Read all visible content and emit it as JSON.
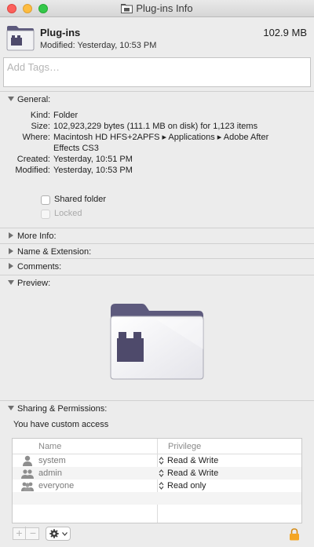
{
  "window": {
    "title": "Plug-ins Info"
  },
  "header": {
    "name": "Plug-ins",
    "size": "102.9 MB",
    "modified": "Modified: Yesterday, 10:53 PM"
  },
  "tags": {
    "placeholder": "Add Tags…",
    "value": ""
  },
  "sections": {
    "general": "General:",
    "more_info": "More Info:",
    "name_extension": "Name & Extension:",
    "comments": "Comments:",
    "preview": "Preview:",
    "sharing": "Sharing & Permissions:"
  },
  "general": {
    "kind_label": "Kind:",
    "kind": "Folder",
    "size_label": "Size:",
    "size": "102,923,229 bytes (111.1 MB on disk) for 1,123 items",
    "where_label": "Where:",
    "where": "Macintosh HD HFS+2APFS ▸ Applications ▸ Adobe After Effects CS3",
    "created_label": "Created:",
    "created": "Yesterday, 10:51 PM",
    "modified_label": "Modified:",
    "modified": "Yesterday, 10:53 PM",
    "shared_folder": "Shared folder",
    "locked": "Locked"
  },
  "sharing": {
    "access": "You have custom access",
    "col_name": "Name",
    "col_privilege": "Privilege",
    "rows": [
      {
        "name": "system",
        "privilege": "Read & Write"
      },
      {
        "name": "admin",
        "privilege": "Read & Write"
      },
      {
        "name": "everyone",
        "privilege": "Read only"
      }
    ]
  },
  "toolbar": {
    "add": "+",
    "remove": "−"
  },
  "colors": {
    "folder_dark": "#4e4a6b",
    "folder_light": "#ffffff",
    "lock": "#f5a623"
  }
}
